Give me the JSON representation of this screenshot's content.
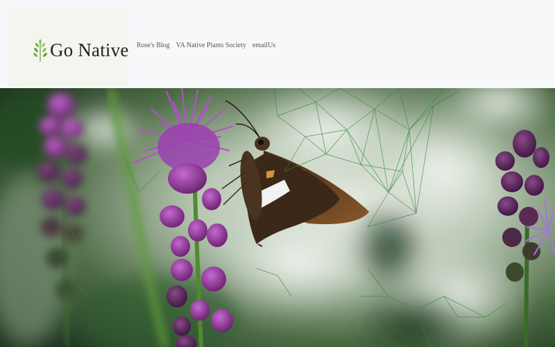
{
  "site": {
    "title": "Go Native",
    "logo_icon": "sprout-icon"
  },
  "nav": {
    "items": [
      {
        "label": "Rose's Blog"
      },
      {
        "label": "VA Native Plants Society"
      },
      {
        "label": "emailUs"
      }
    ]
  },
  "hero": {
    "subject": "butterfly-on-liatris-photo"
  },
  "colors": {
    "header_bg": "#f7f8fa",
    "logo_bg": "#f3f6ee",
    "nav_text": "#555555",
    "network_lines": "#2f8a3a"
  }
}
